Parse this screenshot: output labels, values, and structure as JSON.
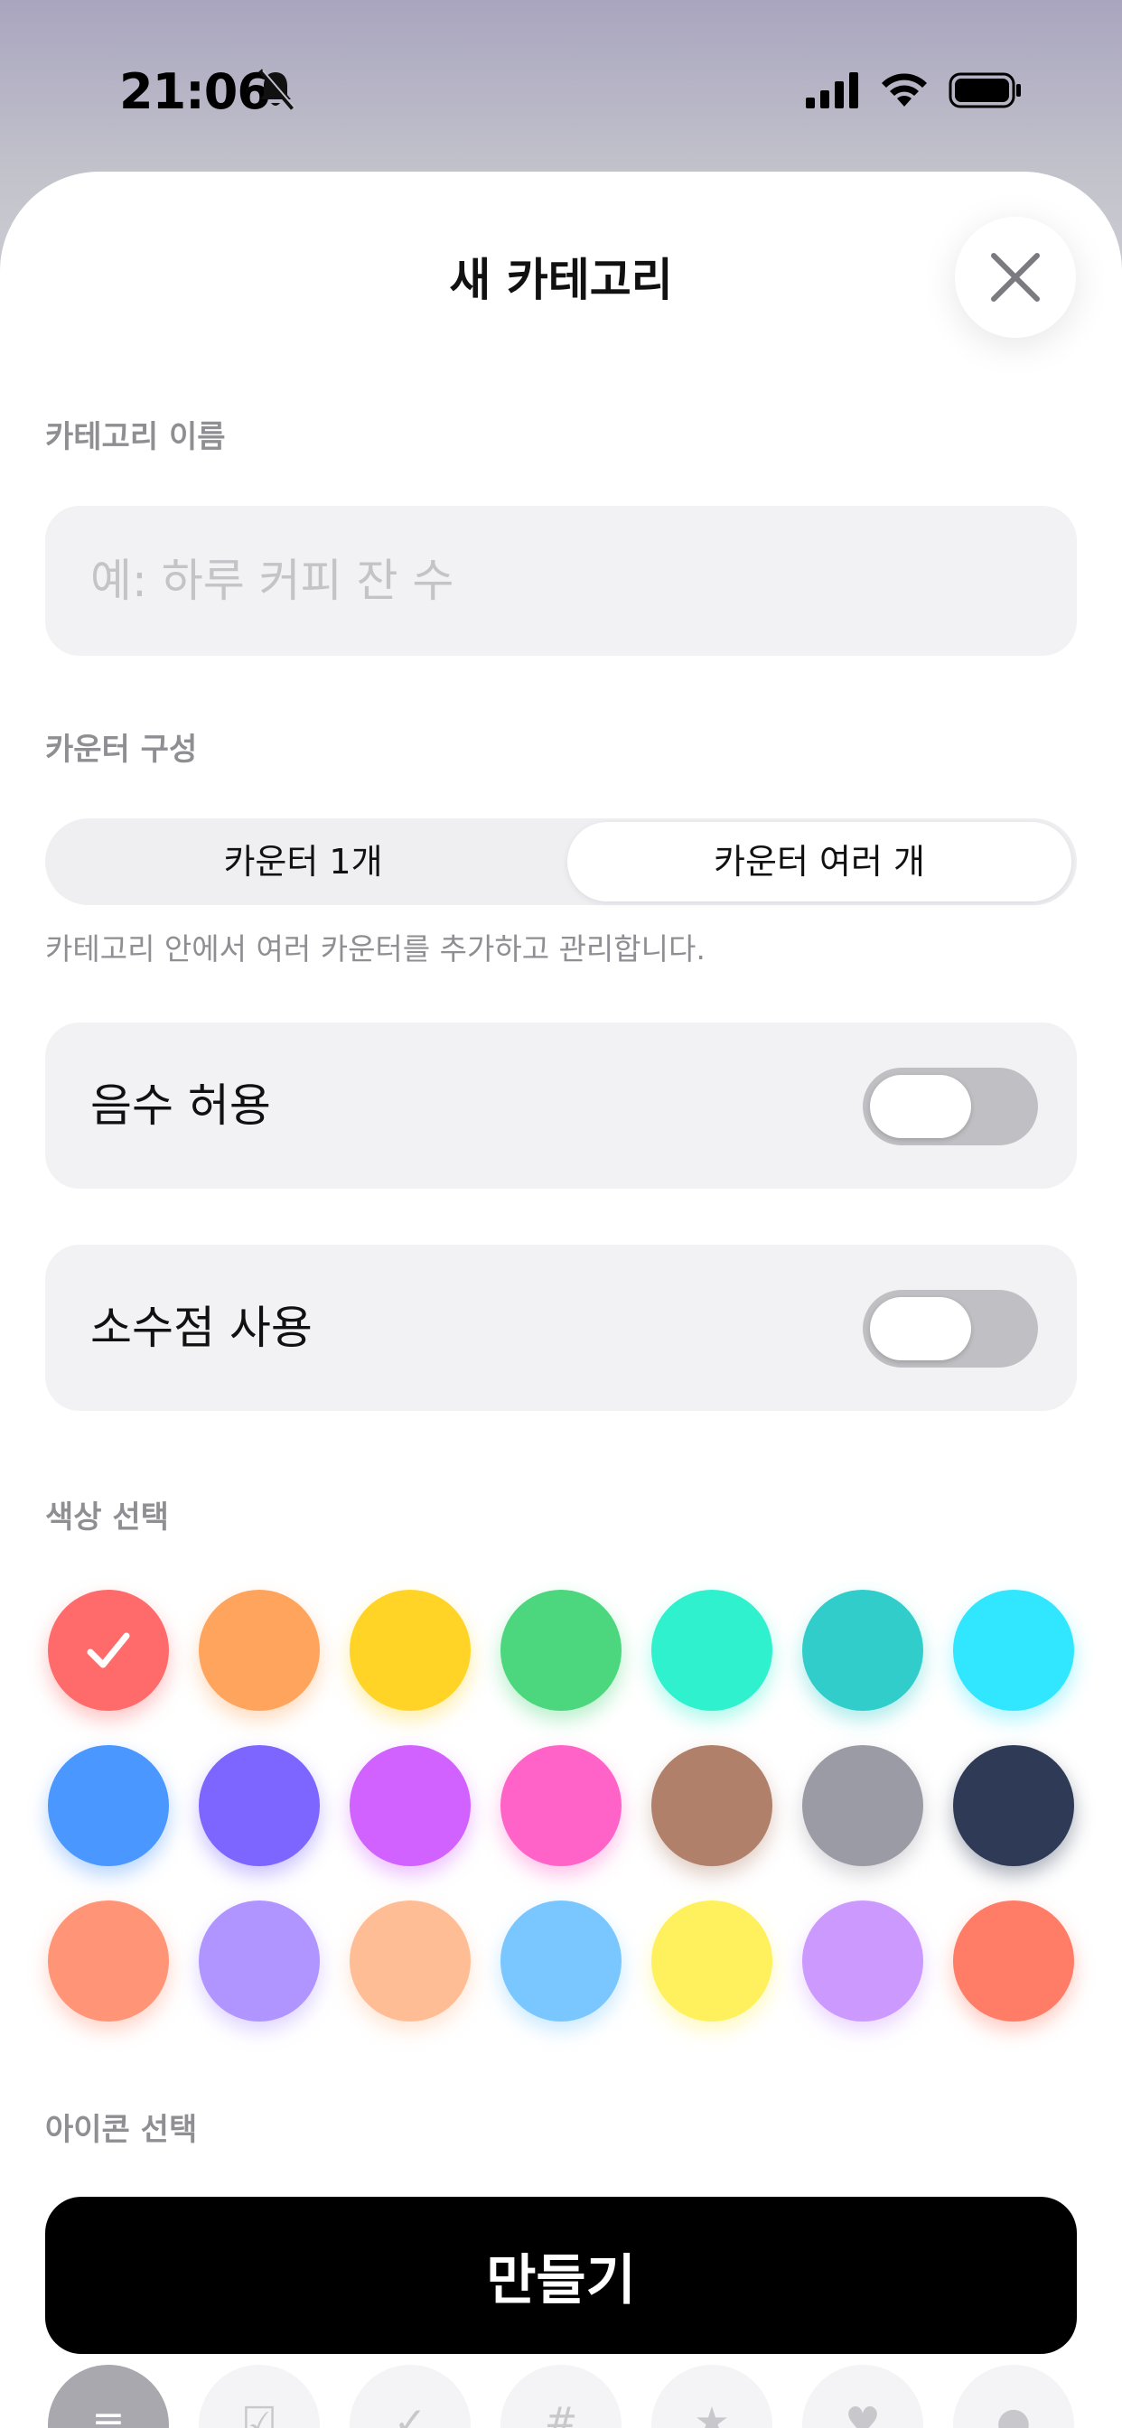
{
  "status_bar": {
    "time": "21:06"
  },
  "sheet": {
    "title": "새 카테고리",
    "name_section": {
      "label": "카테고리 이름",
      "placeholder": "예: 하루 커피 잔 수",
      "value": ""
    },
    "counter_section": {
      "label": "카운터 구성",
      "options": [
        "카운터 1개",
        "카운터 여러 개"
      ],
      "selected": "카운터 여러 개",
      "hint": "카테고리 안에서 여러 카운터를 추가하고 관리합니다."
    },
    "toggles": [
      {
        "label": "음수 허용",
        "on": false
      },
      {
        "label": "소수점 사용",
        "on": false
      }
    ],
    "color_section": {
      "label": "색상 선택",
      "colors": [
        "#ff6b6b",
        "#ffa45c",
        "#ffd426",
        "#4cd67d",
        "#2ff1cd",
        "#30cdcb",
        "#31e6ff",
        "#4a97ff",
        "#7c66ff",
        "#d262ff",
        "#ff63c7",
        "#b0806a",
        "#9b9ba6",
        "#2f3b56",
        "#ff9477",
        "#b094ff",
        "#ffbd96",
        "#7ac7ff",
        "#fff05e",
        "#cc99ff",
        "#ff7c66"
      ],
      "selected_index": 0
    },
    "icon_section": {
      "label": "아이콘 선택",
      "icons": [
        "list-icon",
        "checklist-icon",
        "check-icon",
        "hash-icon",
        "star-icon",
        "heart-icon",
        "drop-icon"
      ],
      "selected_index": 0
    },
    "create_button": "만들기"
  }
}
